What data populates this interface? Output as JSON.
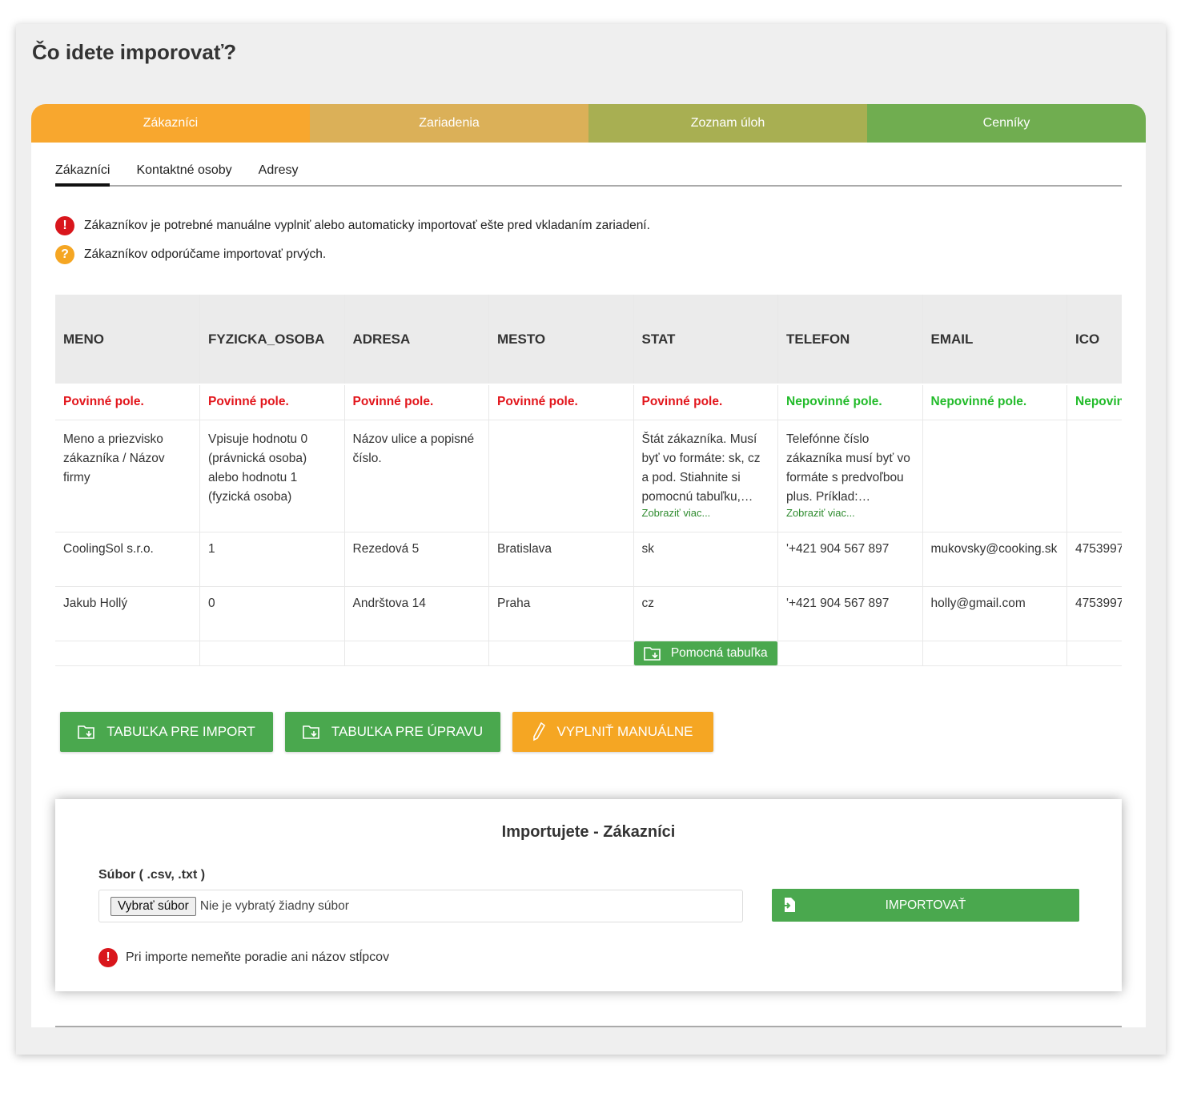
{
  "page": {
    "title": "Čo idete imporovať?"
  },
  "category_tabs": [
    {
      "label": "Zákazníci",
      "color": "#f8a72e"
    },
    {
      "label": "Zariadenia",
      "color": "#dbb058"
    },
    {
      "label": "Zoznam úloh",
      "color": "#a8af52"
    },
    {
      "label": "Cenníky",
      "color": "#70ad50"
    }
  ],
  "sub_tabs": [
    {
      "label": "Zákazníci",
      "active": true
    },
    {
      "label": "Kontaktné osoby",
      "active": false
    },
    {
      "label": "Adresy",
      "active": false
    }
  ],
  "notices": [
    {
      "icon": "exclamation-icon",
      "text": "Zákazníkov je potrebné manuálne vyplniť alebo automaticky importovať ešte pred vkladaním zariadení."
    },
    {
      "icon": "question-icon",
      "text": "Zákazníkov odporúčame importovať prvých."
    }
  ],
  "table": {
    "columns": [
      "MENO",
      "FYZICKA_OSOBA",
      "ADRESA",
      "MESTO",
      "STAT",
      "TELEFON",
      "EMAIL",
      "ICO"
    ],
    "requirement_row": [
      "Povinné pole.",
      "Povinné pole.",
      "Povinné pole.",
      "Povinné pole.",
      "Povinné pole.",
      "Nepovinné pole.",
      "Nepovinné pole.",
      "Nepovinné pole."
    ],
    "descriptions": [
      "Meno a priezvisko zákazníka / Názov firmy",
      "Vpisuje hodnotu 0 (právnická osoba) alebo hodnotu 1 (fyzická osoba)",
      "Názov ulice a popisné číslo.",
      "",
      "Štát zákazníka. Musí byť vo formáte: sk, cz a pod. Stiahnite si pomocnú tabuľku,…",
      "Telefónne číslo zákazníka musí byť vo formáte s predvoľbou plus. Príklad:…",
      "",
      ""
    ],
    "show_more": "Zobraziť viac...",
    "rows": [
      [
        "CoolingSol s.r.o.",
        "1",
        "Rezedová 5",
        "Bratislava",
        "sk",
        "'+421 904 567 897",
        "mukovsky@cooking.sk",
        "4753997"
      ],
      [
        "Jakub Hollý",
        "0",
        "Andrštova 14",
        "Praha",
        "cz",
        "'+421 904 567 897",
        "holly@gmail.com",
        "4753997"
      ]
    ],
    "helper_button": "Pomocná tabuľka"
  },
  "actions": {
    "import_table": "TABUĽKA PRE IMPORT",
    "edit_table": "TABUĽKA PRE ÚPRAVU",
    "fill_manual": "VYPLNIŤ MANUÁLNE"
  },
  "import_panel": {
    "title": "Importujete - Zákazníci",
    "file_label": "Súbor ( .csv, .txt )",
    "choose_file": "Vybrať súbor",
    "no_file": "Nie je vybratý žiadny súbor",
    "import_button": "IMPORTOVAŤ",
    "warning": "Pri importe nemeňte poradie ani názov stĺpcov"
  }
}
